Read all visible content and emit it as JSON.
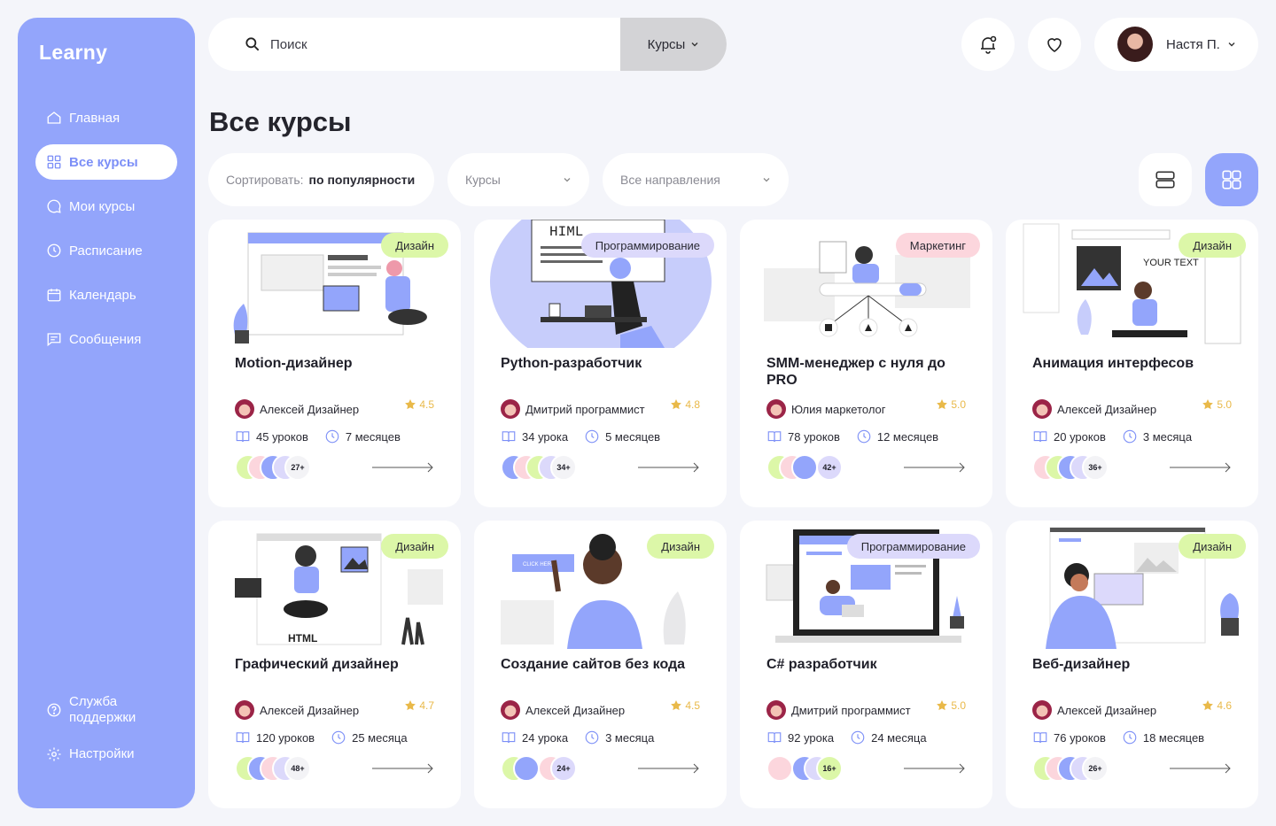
{
  "sidebar": {
    "logo": "Learny",
    "items": [
      {
        "label": "Главная",
        "icon": "home-icon"
      },
      {
        "label": "Все курсы",
        "icon": "grid-icon",
        "active": true
      },
      {
        "label": "Мои курсы",
        "icon": "chat-bubble-icon"
      },
      {
        "label": "Расписание",
        "icon": "clock-icon"
      },
      {
        "label": "Календарь",
        "icon": "calendar-icon"
      },
      {
        "label": "Сообщения",
        "icon": "message-icon"
      }
    ],
    "bottom": [
      {
        "label": "Служба поддержки",
        "icon": "help-icon"
      },
      {
        "label": "Настройки",
        "icon": "gear-icon"
      }
    ]
  },
  "header": {
    "search_placeholder": "Поиск",
    "search_category": "Курсы",
    "user_name": "Настя П."
  },
  "page": {
    "title": "Все курсы",
    "sort_label": "Сортировать:",
    "sort_value": "по популярности",
    "type_filter": "Курсы",
    "direction_filter": "Все направления"
  },
  "colors": {
    "accent": "#93a5fb",
    "design_badge": "#dcf7a8",
    "programming_badge": "#dcd9fb",
    "marketing_badge": "#fcd6dd",
    "star": "#e9b949"
  },
  "courses": [
    {
      "title": "Motion-дизайнер",
      "category": "Дизайн",
      "author": "Алексей Дизайнер",
      "rating": "4.5",
      "lessons": "45 уроков",
      "duration": "7 месяцев",
      "students": "27+"
    },
    {
      "title": "Python-разработчик",
      "category": "Программирование",
      "author": "Дмитрий программист",
      "rating": "4.8",
      "lessons": "34 урока",
      "duration": "5 месяцев",
      "students": "34+"
    },
    {
      "title": "SMM-менеджер с нуля до PRO",
      "category": "Маркетинг",
      "author": "Юлия маркетолог",
      "rating": "5.0",
      "lessons": "78 уроков",
      "duration": "12 месяцев",
      "students": "42+"
    },
    {
      "title": "Анимация интерфесов",
      "category": "Дизайн",
      "author": "Алексей Дизайнер",
      "rating": "5.0",
      "lessons": "20 уроков",
      "duration": "3 месяца",
      "students": "36+"
    },
    {
      "title": "Графический дизайнер",
      "category": "Дизайн",
      "author": "Алексей Дизайнер",
      "rating": "4.7",
      "lessons": "120 уроков",
      "duration": "25 месяца",
      "students": "48+"
    },
    {
      "title": "Создание сайтов без кода",
      "category": "Дизайн",
      "author": "Алексей Дизайнер",
      "rating": "4.5",
      "lessons": "24 урока",
      "duration": "3 месяца",
      "students": "24+"
    },
    {
      "title": "C# разработчик",
      "category": "Программирование",
      "author": "Дмитрий программист",
      "rating": "5.0",
      "lessons": "92 урока",
      "duration": "24 месяца",
      "students": "16+"
    },
    {
      "title": "Веб-дизайнер",
      "category": "Дизайн",
      "author": "Алексей Дизайнер",
      "rating": "4.6",
      "lessons": "76 уроков",
      "duration": "18 месяцев",
      "students": "26+"
    }
  ],
  "illustration_text": {
    "html_sign": "HIML",
    "your_text": "YOUR TEXT",
    "click_here": "CLICK HERE",
    "html_label": "HTML"
  }
}
